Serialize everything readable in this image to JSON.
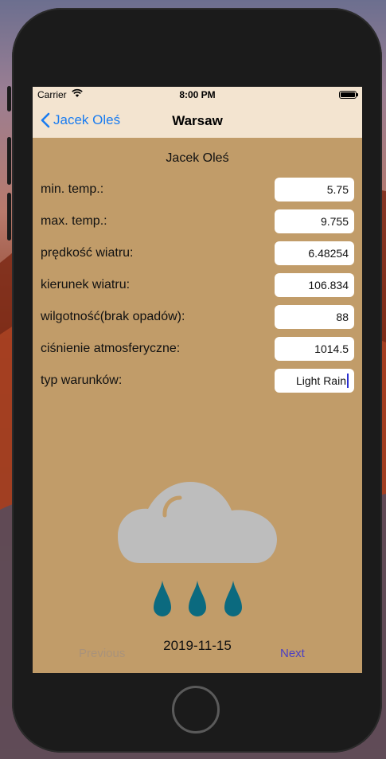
{
  "status_bar": {
    "carrier": "Carrier",
    "time": "8:00 PM"
  },
  "nav": {
    "back_label": "Jacek Oleś",
    "title": "Warsaw"
  },
  "person_name": "Jacek Oleś",
  "fields": [
    {
      "label": "min. temp.:",
      "value": "5.75"
    },
    {
      "label": "max. temp.:",
      "value": "9.755"
    },
    {
      "label": "prędkość wiatru:",
      "value": "6.48254"
    },
    {
      "label": "kierunek wiatru:",
      "value": "106.834"
    },
    {
      "label": "wilgotność(brak opadów):",
      "value": "88"
    },
    {
      "label": "ciśnienie atmosferyczne:",
      "value": "1014.5"
    },
    {
      "label": "typ warunków:",
      "value": "Light Rain"
    }
  ],
  "weather_icon": "light-rain-icon",
  "colors": {
    "screen_background": "#c19c69",
    "bar_background": "#f3e4d0",
    "cloud": "#bdbdbd",
    "raindrop": "#0b6a7f",
    "link": "#1a7cf0",
    "next": "#4b3fc4",
    "previous_disabled": "#a9927a"
  },
  "date": "2019-11-15",
  "previous_label": "Previous",
  "next_label": "Next"
}
